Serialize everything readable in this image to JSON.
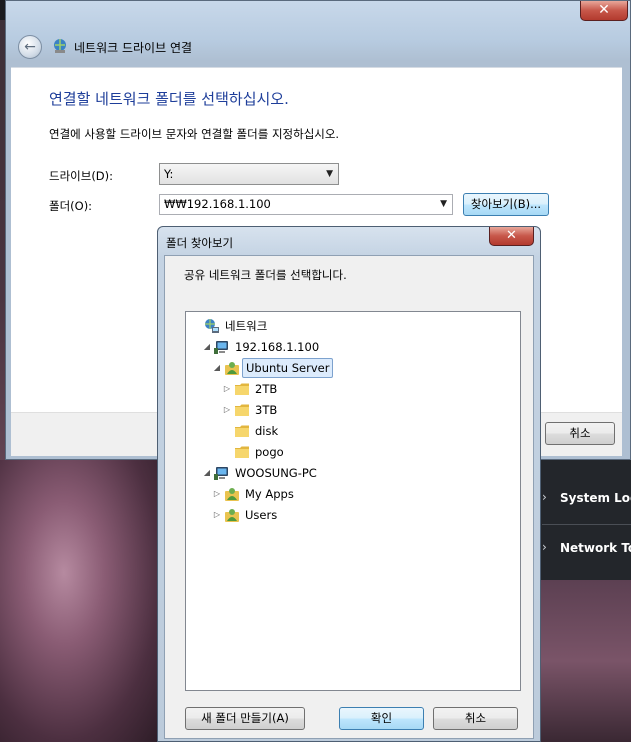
{
  "background": {
    "menu_items": [
      "System Log",
      "Network Tools"
    ]
  },
  "wizard": {
    "title": "네트워크 드라이브 연결",
    "close_glyph": "✕",
    "back_glyph": "←",
    "heading": "연결할 네트워크 폴더를 선택하십시오.",
    "description": "연결에 사용할 드라이브 문자와 연결할 폴더를 지정하십시오.",
    "drive_label": "드라이브(D):",
    "drive_value": "Y:",
    "folder_label": "폴더(O):",
    "folder_value": "₩₩192.168.1.100",
    "browse_label": "찾아보기(B)...",
    "cancel_label": "취소"
  },
  "browse_dialog": {
    "title": "폴더 찾아보기",
    "close_glyph": "✕",
    "description": "공유 네트워크 폴더를 선택합니다.",
    "tree": [
      {
        "label": "네트워크",
        "icon": "network-icon",
        "arrow": "",
        "level": 0
      },
      {
        "label": "192.168.1.100",
        "icon": "computer-icon",
        "arrow": "◢",
        "level": 1
      },
      {
        "label": "Ubuntu Server",
        "icon": "user-share-icon",
        "arrow": "◢",
        "level": 2,
        "selected": true
      },
      {
        "label": "2TB",
        "icon": "folder-icon",
        "arrow": "▷",
        "level": 3
      },
      {
        "label": "3TB",
        "icon": "folder-icon",
        "arrow": "▷",
        "level": 3
      },
      {
        "label": "disk",
        "icon": "folder-icon",
        "arrow": "",
        "level": 3
      },
      {
        "label": "pogo",
        "icon": "folder-icon",
        "arrow": "",
        "level": 3
      },
      {
        "label": "WOOSUNG-PC",
        "icon": "computer-icon",
        "arrow": "◢",
        "level": 1
      },
      {
        "label": "My Apps",
        "icon": "user-share-icon",
        "arrow": "▷",
        "level": 2
      },
      {
        "label": "Users",
        "icon": "user-share-icon",
        "arrow": "▷",
        "level": 2
      }
    ],
    "new_folder_label": "새 폴더 만들기(A)",
    "ok_label": "확인",
    "cancel_label": "취소"
  }
}
